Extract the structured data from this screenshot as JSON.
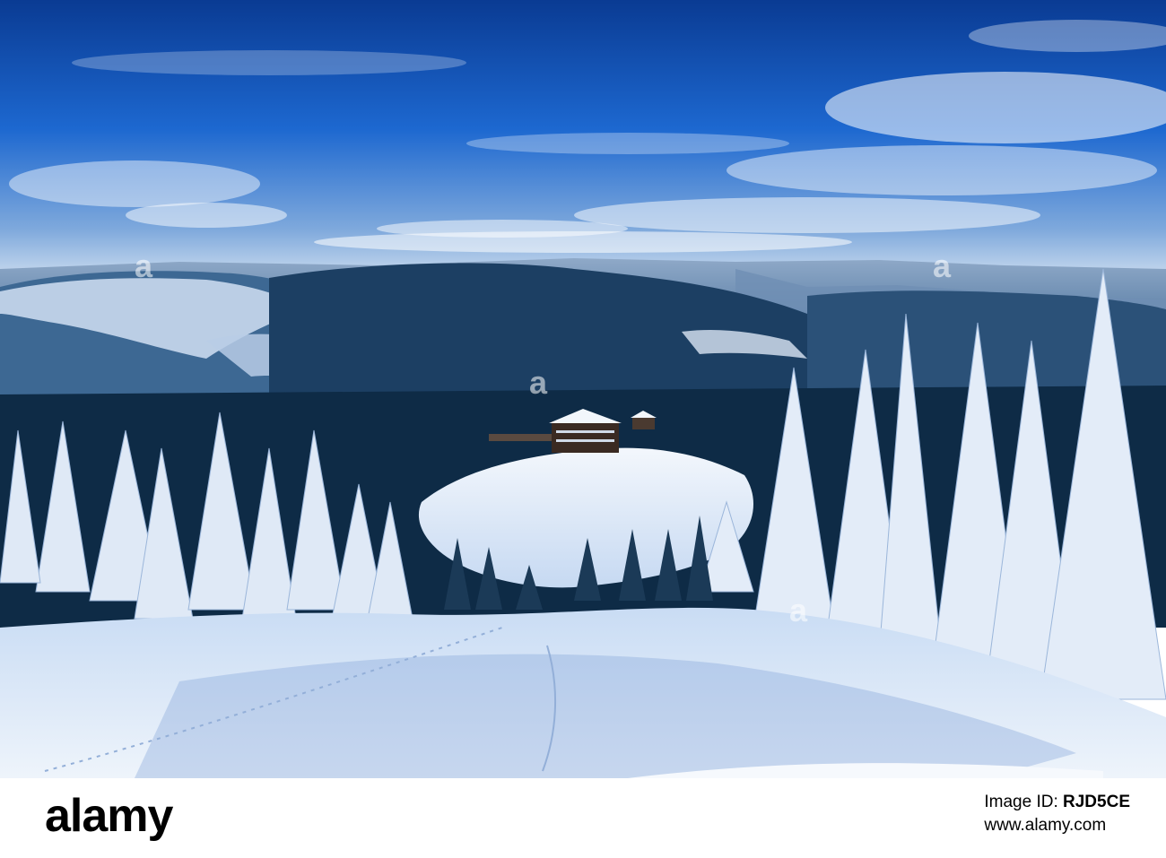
{
  "photo": {
    "description_icon": "winter-landscape-photo",
    "watermark_label": "a",
    "colors": {
      "sky_top": "#0b3f9a",
      "sky_mid": "#1f6ad2",
      "sky_horizon": "#cfe0f2",
      "snow": "#eef4fb",
      "snow_shadow": "#8fb0e0",
      "forest": "#0d2a44",
      "hills": "#3a5f86"
    }
  },
  "footer": {
    "logo": "alamy",
    "image_id_label": "Image ID:",
    "image_id": "RJD5CE",
    "site": "www.alamy.com"
  }
}
